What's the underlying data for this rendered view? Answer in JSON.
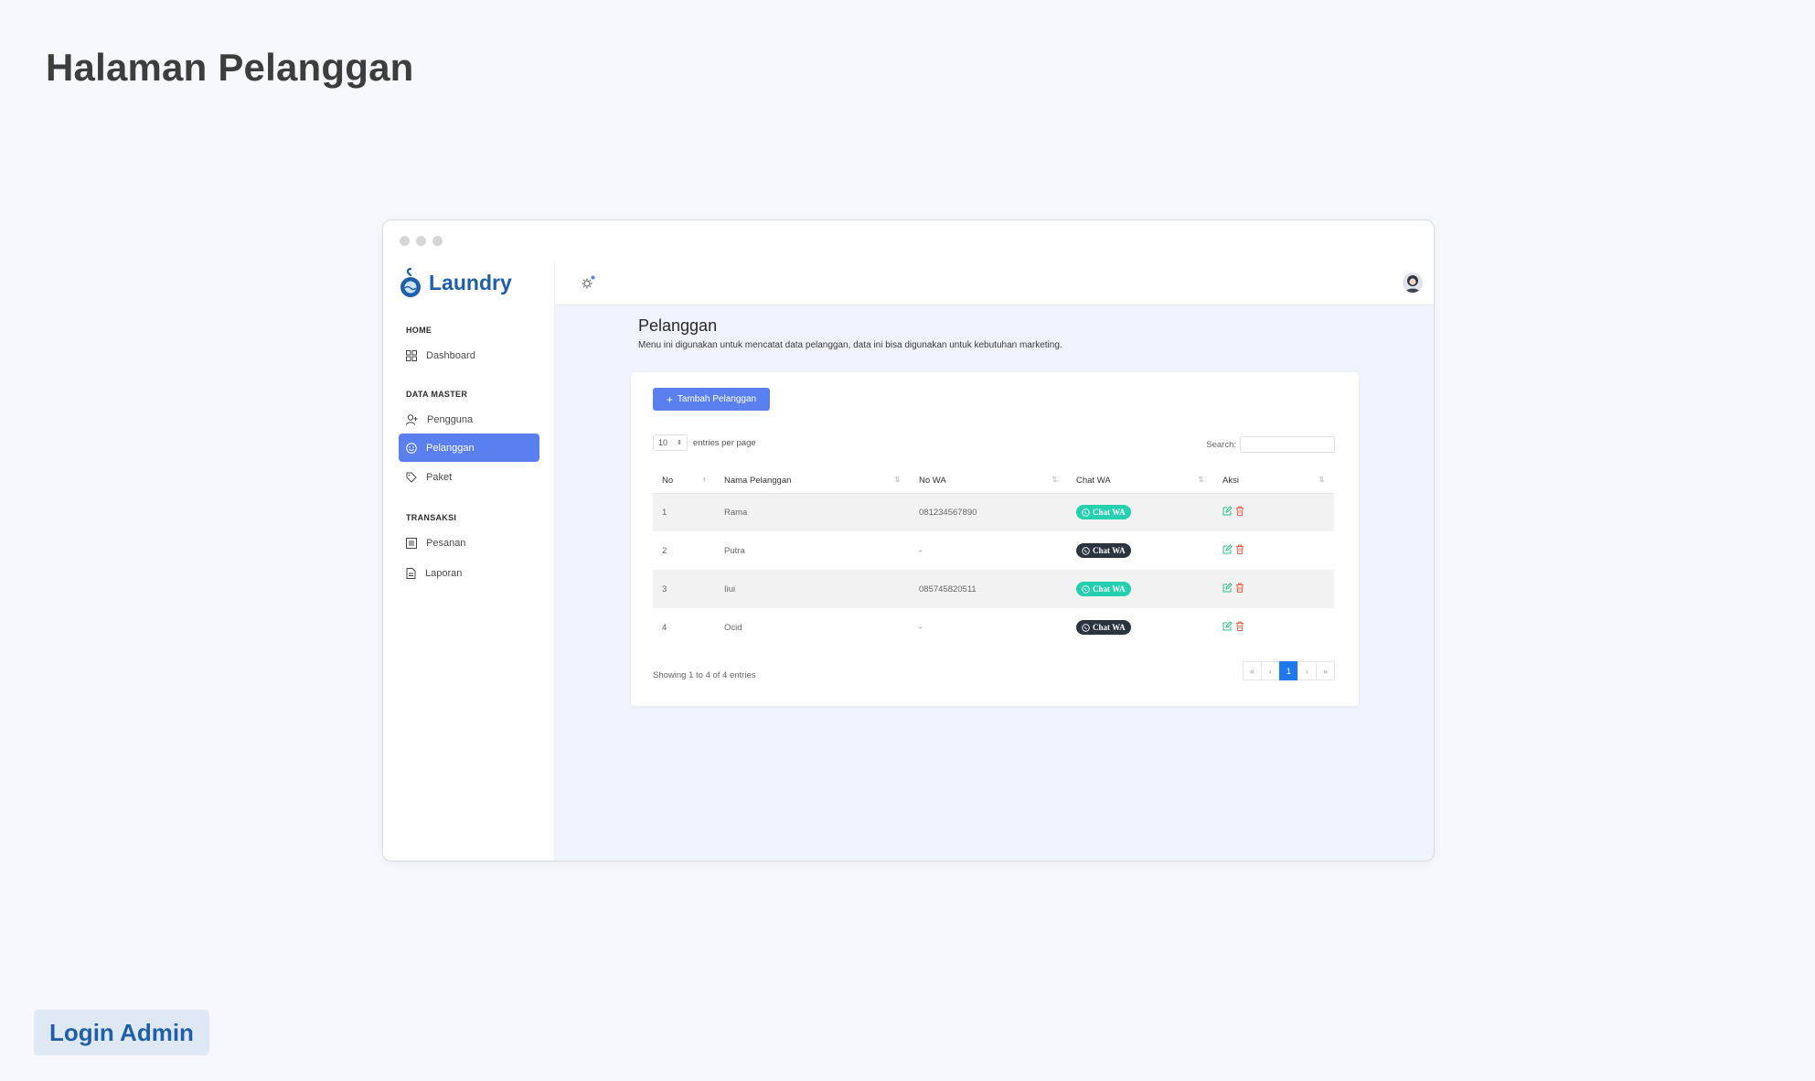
{
  "page_heading": "Halaman Pelanggan",
  "footer_badge": "Login Admin",
  "app": {
    "logo_text": "Laundry",
    "brand_color": "#1f5fa8",
    "accent_color": "#5a80f0"
  },
  "sidebar": {
    "sections": [
      {
        "title": "HOME",
        "items": [
          {
            "label": "Dashboard",
            "icon": "dashboard-grid-icon"
          }
        ]
      },
      {
        "title": "DATA MASTER",
        "items": [
          {
            "label": "Pengguna",
            "icon": "user-add-icon"
          },
          {
            "label": "Pelanggan",
            "icon": "smile-icon",
            "active": true
          },
          {
            "label": "Paket",
            "icon": "tag-icon"
          }
        ]
      },
      {
        "title": "TRANSAKSI",
        "items": [
          {
            "label": "Pesanan",
            "icon": "list-icon"
          },
          {
            "label": "Laporan",
            "icon": "document-icon"
          }
        ]
      }
    ]
  },
  "content": {
    "title": "Pelanggan",
    "description": "Menu ini digunakan untuk mencatat data pelanggan, data ini bisa digunakan untuk kebutuhan marketing.",
    "add_button": "Tambah Pelanggan",
    "entries_value": "10",
    "entries_label": "entries per page",
    "search_label": "Search:",
    "table": {
      "headers": [
        "No",
        "Nama Pelanggan",
        "No WA",
        "Chat WA",
        "Aksi"
      ],
      "rows": [
        {
          "no": "1",
          "name": "Rama",
          "wa": "081234567890",
          "chat": "Chat WA",
          "chat_status": "active"
        },
        {
          "no": "2",
          "name": "Putra",
          "wa": "-",
          "chat": "Chat WA",
          "chat_status": "inactive"
        },
        {
          "no": "3",
          "name": "Iiui",
          "wa": "085745820511",
          "chat": "Chat WA",
          "chat_status": "active"
        },
        {
          "no": "4",
          "name": "Ocid",
          "wa": "-",
          "chat": "Chat WA",
          "chat_status": "inactive"
        }
      ]
    },
    "showing": "Showing 1 to 4 of 4 entries",
    "pagination": [
      "«",
      "‹",
      "1",
      "›",
      "»"
    ],
    "current_page": "1"
  }
}
